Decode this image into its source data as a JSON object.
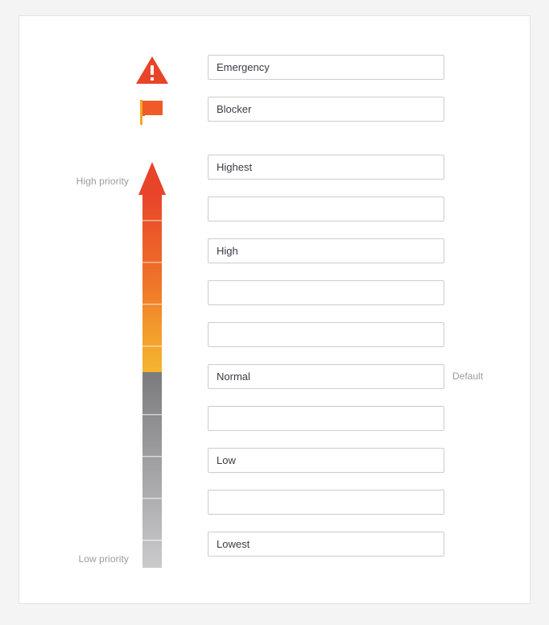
{
  "card": {
    "background": "#ffffff",
    "panel_background": "#f4f4f4"
  },
  "scale": {
    "high_label": "High priority",
    "low_label": "Low priority",
    "icons": [
      {
        "name": "warning-triangle-icon",
        "color": "#e8442a"
      },
      {
        "name": "flag-icon",
        "color": "#f05a28"
      }
    ],
    "gradient_colors": {
      "arrow_top": "#e8442a",
      "mid_orange": "#f07b2a",
      "bottom_yellow": "#f5b52e",
      "gray_top": "#7b7b7e",
      "gray_bottom": "#cfcfcf"
    },
    "segments": [
      {
        "index": 0,
        "color": "#e8442a"
      },
      {
        "index": 1,
        "color": "#ec5c29"
      },
      {
        "index": 2,
        "color": "#ef7429"
      },
      {
        "index": 3,
        "color": "#f28f2a"
      },
      {
        "index": 4,
        "color": "#f5b52e"
      },
      {
        "index": 5,
        "color": "#7b7b7e"
      },
      {
        "index": 6,
        "color": "#95959a"
      },
      {
        "index": 7,
        "color": "#a9a9ad"
      },
      {
        "index": 8,
        "color": "#bdbdc0"
      },
      {
        "index": 9,
        "color": "#cfcfd1"
      }
    ]
  },
  "fields": [
    {
      "value": "Emergency",
      "placeholder": "",
      "note": ""
    },
    {
      "value": "Blocker",
      "placeholder": "",
      "note": ""
    },
    {
      "value": "Highest",
      "placeholder": "",
      "note": ""
    },
    {
      "value": "",
      "placeholder": "",
      "note": ""
    },
    {
      "value": "High",
      "placeholder": "",
      "note": ""
    },
    {
      "value": "",
      "placeholder": "",
      "note": ""
    },
    {
      "value": "",
      "placeholder": "",
      "note": ""
    },
    {
      "value": "Normal",
      "placeholder": "",
      "note": "Default"
    },
    {
      "value": "",
      "placeholder": "",
      "note": ""
    },
    {
      "value": "Low",
      "placeholder": "",
      "note": ""
    },
    {
      "value": "",
      "placeholder": "",
      "note": ""
    },
    {
      "value": "Lowest",
      "placeholder": "",
      "note": ""
    }
  ]
}
